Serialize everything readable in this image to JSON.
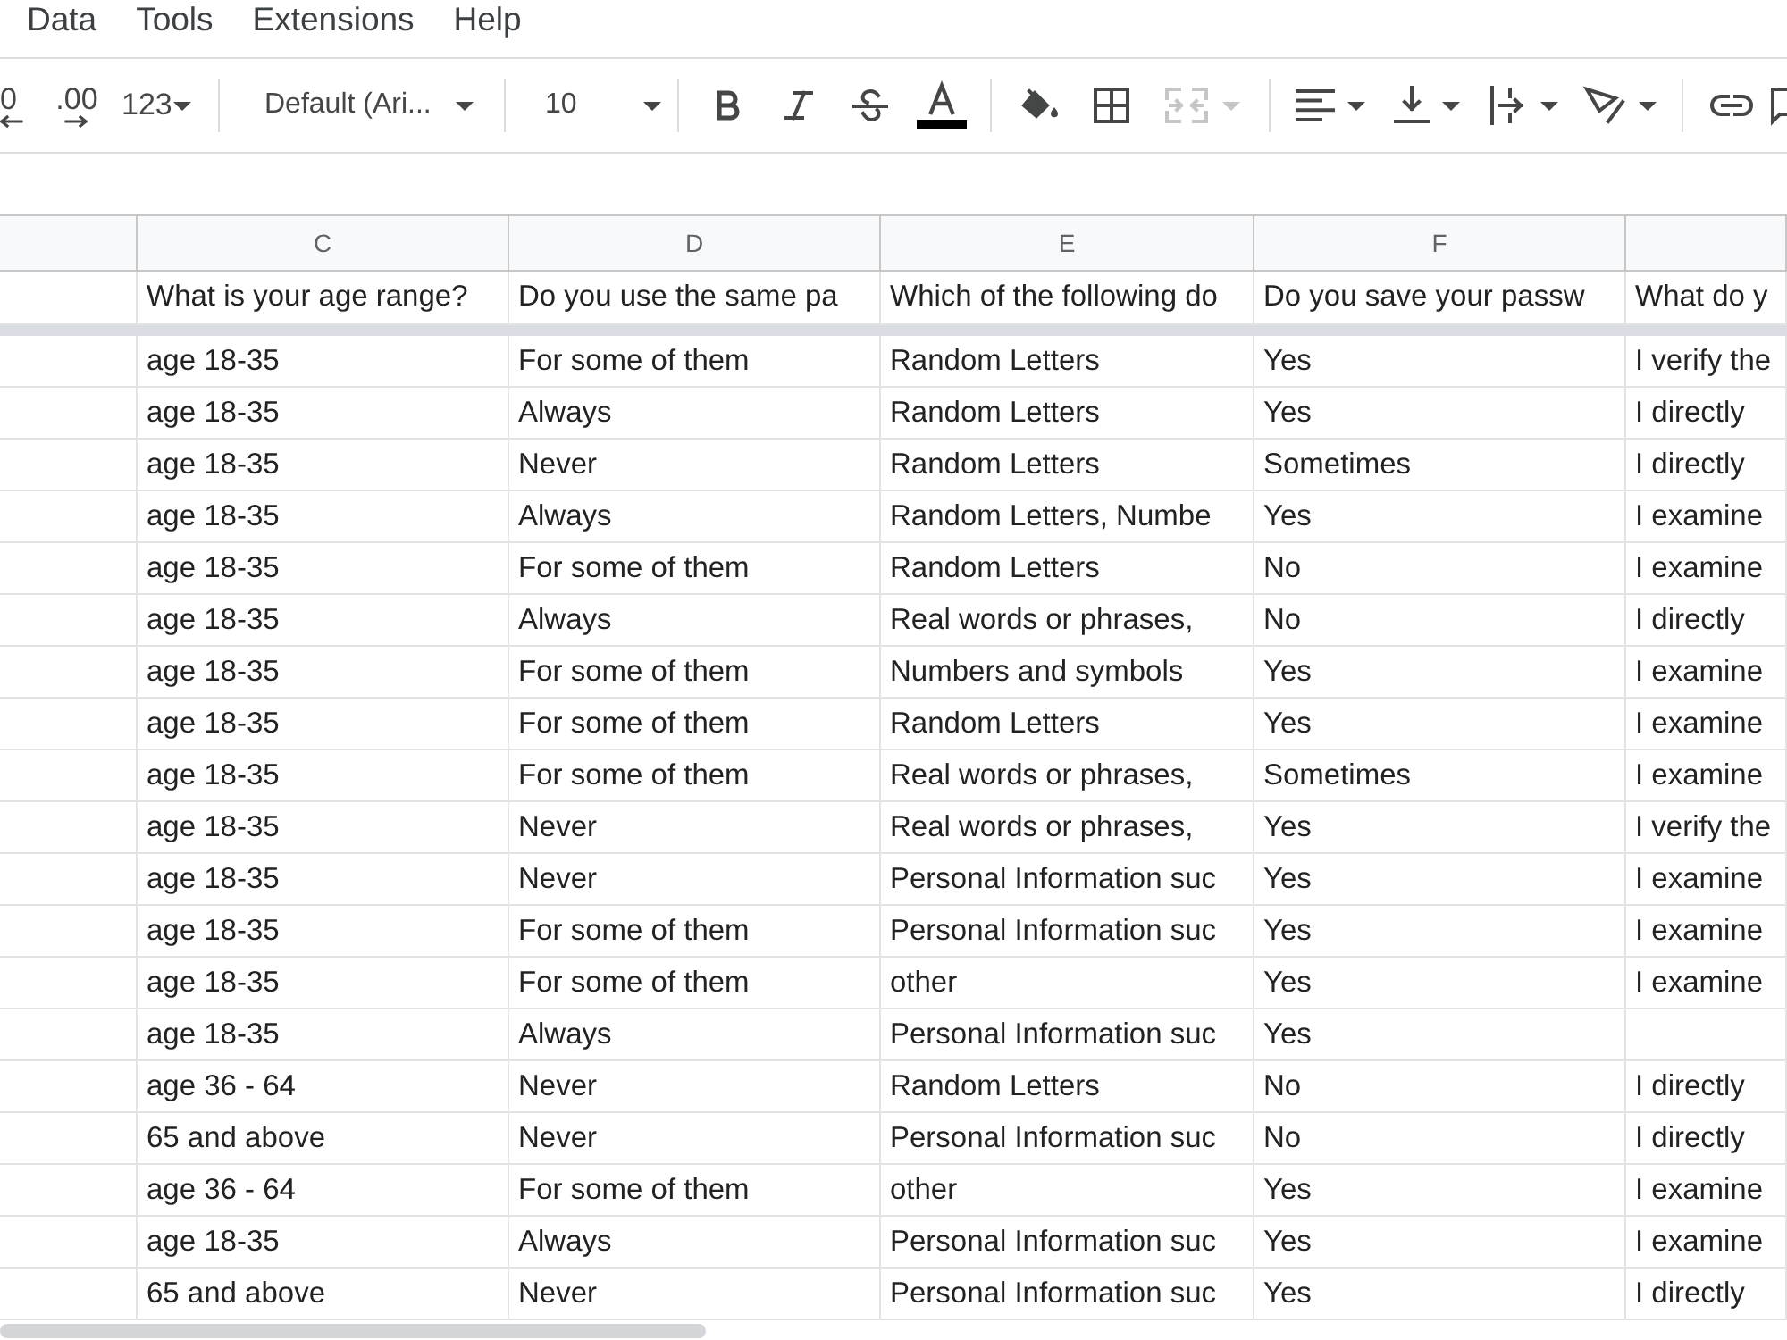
{
  "menu": [
    {
      "label": "Data"
    },
    {
      "label": "Tools"
    },
    {
      "label": "Extensions"
    },
    {
      "label": "Help"
    }
  ],
  "toolbar": {
    "groups": [
      [
        {
          "kind": "decrease",
          "label": "0",
          "disabled": false
        },
        {
          "kind": "increase",
          "label": ".00",
          "disabled": false
        },
        {
          "kind": "format",
          "label": "123",
          "disabled": false
        }
      ],
      [
        {
          "kind": "font",
          "label": "Default (Ari...",
          "disabled": false
        }
      ],
      [
        {
          "kind": "size",
          "label": "10",
          "disabled": false
        }
      ],
      [
        {
          "kind": "bold",
          "disabled": false
        },
        {
          "kind": "italic",
          "disabled": false
        },
        {
          "kind": "strikethrough",
          "disabled": false
        },
        {
          "kind": "textcolor",
          "disabled": false
        }
      ],
      [
        {
          "kind": "fill",
          "disabled": false
        },
        {
          "kind": "borders",
          "disabled": false
        },
        {
          "kind": "merge",
          "disabled": true
        }
      ],
      [
        {
          "kind": "halign",
          "disabled": false
        },
        {
          "kind": "valign",
          "disabled": false
        },
        {
          "kind": "wrap",
          "disabled": false
        },
        {
          "kind": "rotate",
          "disabled": false
        }
      ],
      [
        {
          "kind": "link",
          "disabled": false
        },
        {
          "kind": "comment",
          "disabled": false
        }
      ]
    ]
  },
  "sheet": {
    "column_letters": [
      "C",
      "D",
      "E",
      "F"
    ],
    "header_row": [
      "What is your age range?",
      "Do you use the same pa",
      "Which of the following do",
      "Do you save your passw",
      "What do y"
    ],
    "rows": [
      [
        "age 18-35",
        "For some of them",
        "Random Letters",
        "Yes",
        "I verify the"
      ],
      [
        "age 18-35",
        "Always",
        "Random Letters",
        "Yes",
        "I directly"
      ],
      [
        "age 18-35",
        "Never",
        "Random Letters",
        "Sometimes",
        "I directly"
      ],
      [
        "age 18-35",
        "Always",
        "Random Letters, Numbe",
        "Yes",
        "I examine"
      ],
      [
        "age 18-35",
        "For some of them",
        "Random Letters",
        "No",
        "I examine"
      ],
      [
        "age 18-35",
        "Always",
        "Real words or phrases,",
        "No",
        "I directly"
      ],
      [
        "age 18-35",
        "For some of them",
        "Numbers and symbols",
        "Yes",
        "I examine"
      ],
      [
        "age 18-35",
        "For some of them",
        "Random Letters",
        "Yes",
        "I examine"
      ],
      [
        "age 18-35",
        "For some of them",
        "Real words or phrases,",
        "Sometimes",
        "I examine"
      ],
      [
        "age 18-35",
        "Never",
        "Real words or phrases,",
        "Yes",
        "I verify the"
      ],
      [
        "age 18-35",
        "Never",
        "Personal Information suc",
        "Yes",
        "I examine"
      ],
      [
        "age 18-35",
        "For some of them",
        "Personal Information suc",
        "Yes",
        "I examine"
      ],
      [
        "age 18-35",
        "For some of them",
        "other",
        "Yes",
        "I examine"
      ],
      [
        "age 18-35",
        "Always",
        "Personal Information suc",
        "Yes"
      ],
      [
        "age 36 - 64",
        "Never",
        "Random Letters",
        "No",
        "I directly"
      ],
      [
        "65 and above",
        "Never",
        "Personal Information suc",
        "No",
        "I directly"
      ],
      [
        "age 36 - 64",
        "For some of them",
        "other",
        "Yes",
        "I examine"
      ],
      [
        "age 18-35",
        "Always",
        "Personal Information suc",
        "Yes",
        "I examine"
      ],
      [
        "65 and above",
        "Never",
        "Personal Information suc",
        "Yes",
        "I directly"
      ]
    ]
  }
}
